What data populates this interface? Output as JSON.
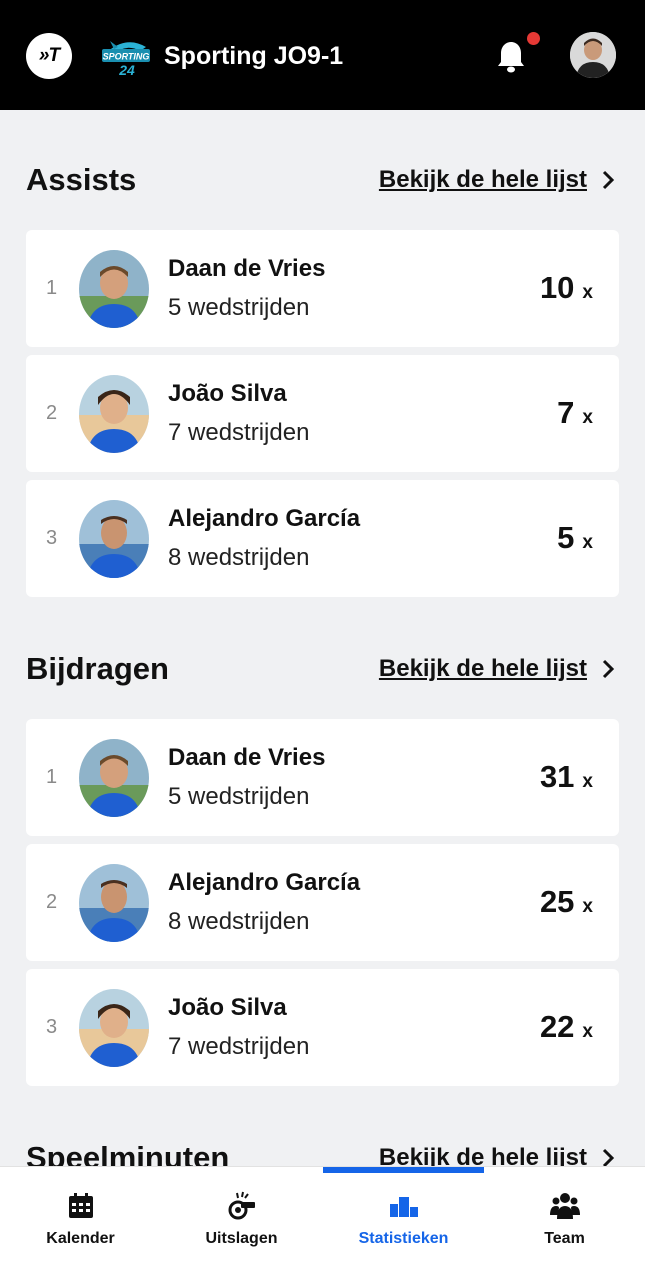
{
  "header": {
    "app_logo_text": "»T",
    "club_logo_text": "SPORTING 24",
    "team_name": "Sporting JO9-1"
  },
  "sections": [
    {
      "title": "Assists",
      "see_all": "Bekijk de hele lijst",
      "rows": [
        {
          "rank": "1",
          "name": "Daan de Vries",
          "matches": "5 wedstrijden",
          "value": "10",
          "unit": "x"
        },
        {
          "rank": "2",
          "name": "João Silva",
          "matches": "7 wedstrijden",
          "value": "7",
          "unit": "x"
        },
        {
          "rank": "3",
          "name": "Alejandro García",
          "matches": "8 wedstrijden",
          "value": "5",
          "unit": "x"
        }
      ]
    },
    {
      "title": "Bijdragen",
      "see_all": "Bekijk de hele lijst",
      "rows": [
        {
          "rank": "1",
          "name": "Daan de Vries",
          "matches": "5 wedstrijden",
          "value": "31",
          "unit": "x"
        },
        {
          "rank": "2",
          "name": "Alejandro García",
          "matches": "8 wedstrijden",
          "value": "25",
          "unit": "x"
        },
        {
          "rank": "3",
          "name": "João Silva",
          "matches": "7 wedstrijden",
          "value": "22",
          "unit": "x"
        }
      ]
    },
    {
      "title": "Speelminuten",
      "see_all": "Bekijk de hele lijst"
    }
  ],
  "nav": {
    "items": [
      {
        "label": "Kalender",
        "icon": "calendar-icon"
      },
      {
        "label": "Uitslagen",
        "icon": "whistle-icon"
      },
      {
        "label": "Statistieken",
        "icon": "podium-icon"
      },
      {
        "label": "Team",
        "icon": "team-icon"
      }
    ],
    "active": "Statistieken"
  },
  "colors": {
    "accent": "#1565e8",
    "notification": "#e53935",
    "header_bg": "#000000",
    "page_bg": "#f0f1f3"
  }
}
